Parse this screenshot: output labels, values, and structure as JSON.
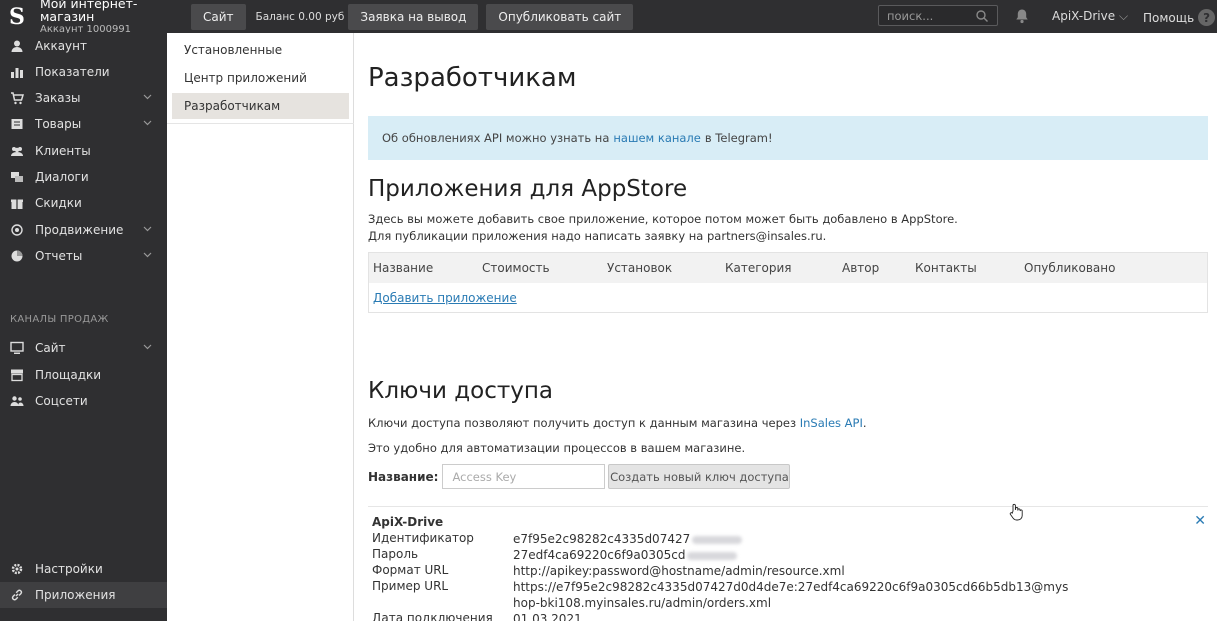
{
  "topbar": {
    "store_name": "Мой интернет-магазин",
    "account": "Аккаунт 1000991",
    "site_btn": "Сайт",
    "balance": "Баланс 0.00 руб",
    "withdraw_btn": "Заявка на вывод",
    "publish_btn": "Опубликовать сайт",
    "search_placeholder": "поиск...",
    "user": "ApiX-Drive",
    "help": "Помощь"
  },
  "sidebar": {
    "items": [
      {
        "label": "Аккаунт",
        "icon": "user-icon"
      },
      {
        "label": "Показатели",
        "icon": "chart-icon"
      },
      {
        "label": "Заказы",
        "icon": "cart-icon"
      },
      {
        "label": "Товары",
        "icon": "box-icon"
      },
      {
        "label": "Клиенты",
        "icon": "users-icon"
      },
      {
        "label": "Диалоги",
        "icon": "chat-icon"
      },
      {
        "label": "Скидки",
        "icon": "gift-icon"
      },
      {
        "label": "Продвижение",
        "icon": "target-icon"
      },
      {
        "label": "Отчеты",
        "icon": "pie-icon"
      }
    ],
    "section_title": "КАНАЛЫ ПРОДАЖ",
    "channels": [
      {
        "label": "Сайт",
        "icon": "monitor-icon"
      },
      {
        "label": "Площадки",
        "icon": "store-icon"
      },
      {
        "label": "Соцсети",
        "icon": "people-icon"
      }
    ],
    "bottom": [
      {
        "label": "Настройки",
        "icon": "gear-icon"
      },
      {
        "label": "Приложения",
        "icon": "link-icon"
      }
    ]
  },
  "subsidebar": {
    "items": [
      "Установленные",
      "Центр приложений",
      "Разработчикам"
    ]
  },
  "main": {
    "title": "Разработчикам",
    "alert_pre": "Об обновлениях API можно узнать на",
    "alert_link": "нашем канале",
    "alert_post": "в Telegram!",
    "appstore_title": "Приложения для AppStore",
    "appstore_p1": "Здесь вы можете добавить свое приложение, которое потом может быть добавлено в AppStore.",
    "appstore_p2": "Для публикации приложения надо написать заявку на partners@insales.ru.",
    "table_headers": [
      "Название",
      "Стоимость",
      "Установок",
      "Категория",
      "Автор",
      "Контакты",
      "Опубликовано"
    ],
    "add_app": "Добавить приложение",
    "keys_title": "Ключи доступа",
    "keys_p1_pre": "Ключи доступа позволяют получить доступ к данным магазина через",
    "keys_p1_link": "InSales API",
    "keys_p1_post": ".",
    "keys_p2": "Это удобно для автоматизации процессов в вашем магазине.",
    "form_label": "Название:",
    "form_placeholder": "Access Key",
    "form_button": "Создать новый ключ доступа",
    "key": {
      "name": "ApiX-Drive",
      "rows": [
        {
          "label": "Идентификатор",
          "value": "e7f95e2c98282c4335d07427"
        },
        {
          "label": "Пароль",
          "value": "27edf4ca69220c6f9a0305cd"
        },
        {
          "label": "Формат URL",
          "value": "http://apikey:password@hostname/admin/resource.xml"
        },
        {
          "label": "Пример URL",
          "value": "https://e7f95e2c98282c4335d07427d0d4de7e:27edf4ca69220c6f9a0305cd66b5db13@myshop-bki108.myinsales.ru/admin/orders.xml"
        },
        {
          "label": "Дата подключения",
          "value": "01.03.2021"
        }
      ]
    }
  }
}
